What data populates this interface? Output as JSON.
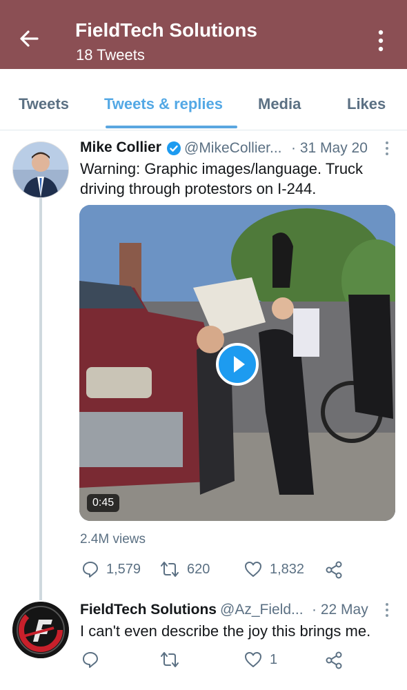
{
  "header": {
    "title": "FieldTech Solutions",
    "subtitle": "18 Tweets",
    "bg_color": "#8b4f54"
  },
  "tabs": [
    {
      "label": "Tweets"
    },
    {
      "label": "Tweets & replies",
      "active": true
    },
    {
      "label": "Media"
    },
    {
      "label": "Likes"
    }
  ],
  "tweet1": {
    "name": "Mike Collier",
    "verified": true,
    "handle": "@MikeCollier...",
    "date": "· 31 May 20",
    "text_line1": "Warning: Graphic images/language. Truck",
    "text_line2": "driving through protestors on I-244.",
    "video_duration": "0:45",
    "views": "2.4M views",
    "replies": "1,579",
    "retweets": "620",
    "likes": "1,832"
  },
  "tweet2": {
    "name": "FieldTech Solutions",
    "handle": "@Az_Field...",
    "date": "· 22 May",
    "text": "I can't even describe the joy this brings me.",
    "likes": "1"
  },
  "colors": {
    "accent": "#1d9bf0",
    "muted": "#5b7083"
  }
}
